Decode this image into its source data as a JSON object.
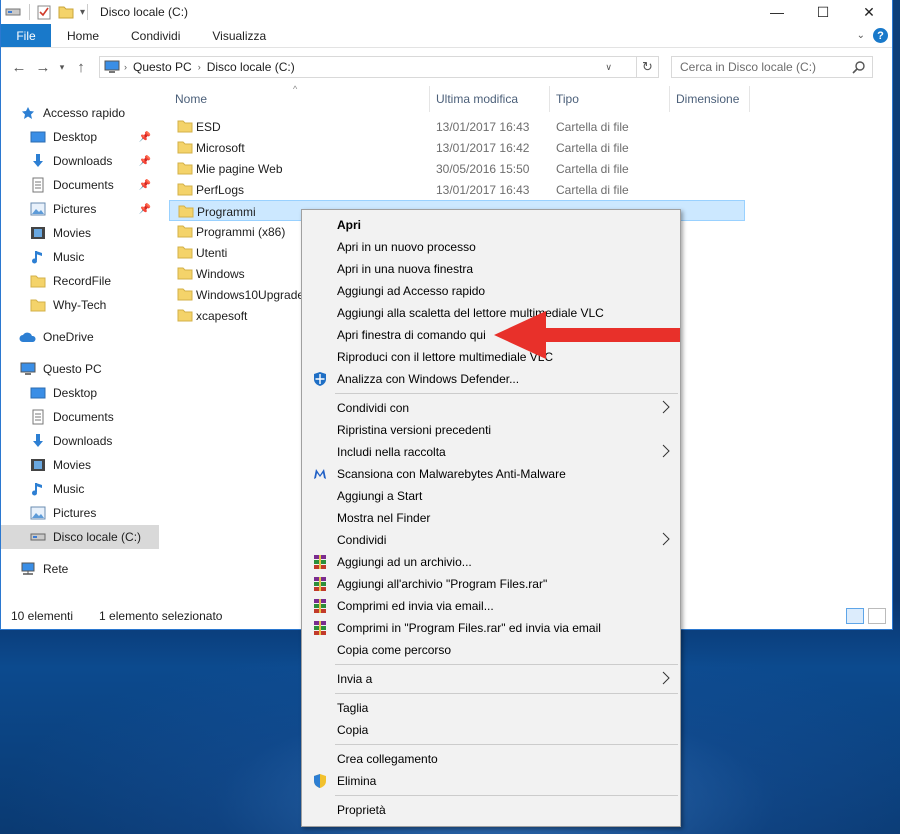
{
  "window": {
    "title": "Disco locale (C:)",
    "controls": {
      "minimize": "—",
      "maximize": "☐",
      "close": "✕"
    }
  },
  "ribbon": {
    "file": "File",
    "tabs": [
      "Home",
      "Condividi",
      "Visualizza"
    ],
    "help": "?"
  },
  "address": {
    "crumbs": [
      "Questo PC",
      "Disco locale (C:)"
    ],
    "search_placeholder": "Cerca in Disco locale (C:)"
  },
  "nav": {
    "quick_access": "Accesso rapido",
    "quick_items": [
      "Desktop",
      "Downloads",
      "Documents",
      "Pictures",
      "Movies",
      "Music",
      "RecordFile",
      "Why-Tech"
    ],
    "onedrive": "OneDrive",
    "this_pc": "Questo PC",
    "pc_items": [
      "Desktop",
      "Documents",
      "Downloads",
      "Movies",
      "Music",
      "Pictures",
      "Disco locale (C:)"
    ],
    "network": "Rete"
  },
  "columns": {
    "name": "Nome",
    "modified": "Ultima modifica",
    "type": "Tipo",
    "size": "Dimensione"
  },
  "files": [
    {
      "name": "ESD",
      "date": "13/01/2017 16:43",
      "type": "Cartella di file"
    },
    {
      "name": "Microsoft",
      "date": "13/01/2017 16:42",
      "type": "Cartella di file"
    },
    {
      "name": "Mie pagine Web",
      "date": "30/05/2016 15:50",
      "type": "Cartella di file"
    },
    {
      "name": "PerfLogs",
      "date": "13/01/2017 16:43",
      "type": "Cartella di file"
    },
    {
      "name": "Programmi",
      "date": "",
      "type": ""
    },
    {
      "name": "Programmi (x86)",
      "date": "",
      "type": ""
    },
    {
      "name": "Utenti",
      "date": "",
      "type": ""
    },
    {
      "name": "Windows",
      "date": "",
      "type": ""
    },
    {
      "name": "Windows10Upgrade",
      "date": "",
      "type": ""
    },
    {
      "name": "xcapesoft",
      "date": "",
      "type": ""
    }
  ],
  "status": {
    "count": "10 elementi",
    "selected": "1 elemento selezionato"
  },
  "context_menu": {
    "g1": [
      "Apri",
      "Apri in un nuovo processo",
      "Apri in una nuova finestra",
      "Aggiungi ad Accesso rapido",
      "Aggiungi alla scaletta del lettore multimediale VLC",
      "Apri finestra di comando qui",
      "Riproduci con il lettore multimediale VLC",
      "Analizza con Windows Defender..."
    ],
    "g2": [
      "Condividi con",
      "Ripristina versioni precedenti",
      "Includi nella raccolta",
      "Scansiona con Malwarebytes Anti-Malware",
      "Aggiungi a Start",
      "Mostra nel Finder",
      "Condividi",
      "Aggiungi ad un archivio...",
      "Aggiungi all'archivio \"Program Files.rar\"",
      "Comprimi ed invia via email...",
      "Comprimi in \"Program Files.rar\" ed invia via email",
      "Copia come percorso"
    ],
    "g3": [
      "Invia a"
    ],
    "g4": [
      "Taglia",
      "Copia"
    ],
    "g5": [
      "Crea collegamento",
      "Elimina"
    ],
    "g6": [
      "Proprietà"
    ]
  },
  "colors": {
    "accent": "#1979ca",
    "selection": "#cce8ff",
    "arrow": "#e8302a",
    "folder": "#f4d36a"
  }
}
